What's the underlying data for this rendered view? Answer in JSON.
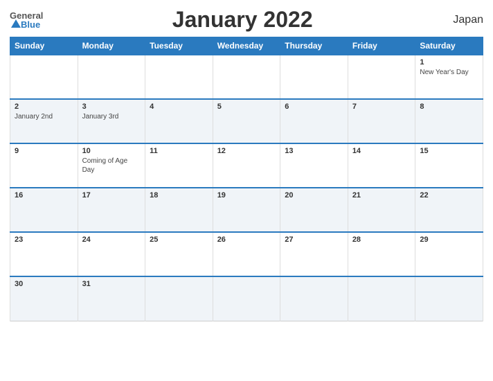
{
  "header": {
    "logo_general": "General",
    "logo_blue": "Blue",
    "title": "January 2022",
    "country": "Japan"
  },
  "calendar": {
    "days_of_week": [
      "Sunday",
      "Monday",
      "Tuesday",
      "Wednesday",
      "Thursday",
      "Friday",
      "Saturday"
    ],
    "weeks": [
      [
        {
          "date": "",
          "event": ""
        },
        {
          "date": "",
          "event": ""
        },
        {
          "date": "",
          "event": ""
        },
        {
          "date": "",
          "event": ""
        },
        {
          "date": "",
          "event": ""
        },
        {
          "date": "",
          "event": ""
        },
        {
          "date": "1",
          "event": "New Year's Day"
        }
      ],
      [
        {
          "date": "2",
          "event": "January 2nd"
        },
        {
          "date": "3",
          "event": "January 3rd"
        },
        {
          "date": "4",
          "event": ""
        },
        {
          "date": "5",
          "event": ""
        },
        {
          "date": "6",
          "event": ""
        },
        {
          "date": "7",
          "event": ""
        },
        {
          "date": "8",
          "event": ""
        }
      ],
      [
        {
          "date": "9",
          "event": ""
        },
        {
          "date": "10",
          "event": "Coming of Age Day"
        },
        {
          "date": "11",
          "event": ""
        },
        {
          "date": "12",
          "event": ""
        },
        {
          "date": "13",
          "event": ""
        },
        {
          "date": "14",
          "event": ""
        },
        {
          "date": "15",
          "event": ""
        }
      ],
      [
        {
          "date": "16",
          "event": ""
        },
        {
          "date": "17",
          "event": ""
        },
        {
          "date": "18",
          "event": ""
        },
        {
          "date": "19",
          "event": ""
        },
        {
          "date": "20",
          "event": ""
        },
        {
          "date": "21",
          "event": ""
        },
        {
          "date": "22",
          "event": ""
        }
      ],
      [
        {
          "date": "23",
          "event": ""
        },
        {
          "date": "24",
          "event": ""
        },
        {
          "date": "25",
          "event": ""
        },
        {
          "date": "26",
          "event": ""
        },
        {
          "date": "27",
          "event": ""
        },
        {
          "date": "28",
          "event": ""
        },
        {
          "date": "29",
          "event": ""
        }
      ],
      [
        {
          "date": "30",
          "event": ""
        },
        {
          "date": "31",
          "event": ""
        },
        {
          "date": "",
          "event": ""
        },
        {
          "date": "",
          "event": ""
        },
        {
          "date": "",
          "event": ""
        },
        {
          "date": "",
          "event": ""
        },
        {
          "date": "",
          "event": ""
        }
      ]
    ]
  }
}
